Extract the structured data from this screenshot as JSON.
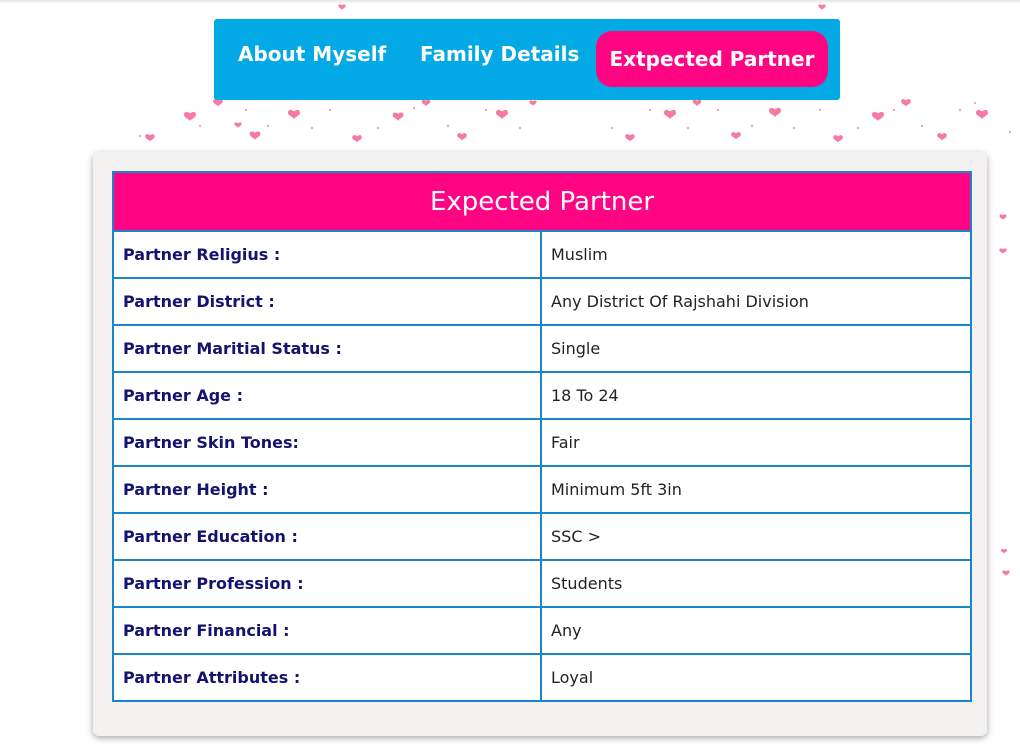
{
  "tabs": [
    {
      "label": "About Myself"
    },
    {
      "label": "Family Details"
    },
    {
      "label": "Extpected Partner"
    }
  ],
  "table": {
    "title": "Expected Partner",
    "rows": [
      {
        "label": "Partner Religius :",
        "value": "Muslim"
      },
      {
        "label": "Partner District :",
        "value": "Any District Of Rajshahi Division"
      },
      {
        "label": "Partner Maritial Status :",
        "value": "Single"
      },
      {
        "label": "Partner Age :",
        "value": "18 To 24"
      },
      {
        "label": "Partner Skin Tones:",
        "value": "Fair"
      },
      {
        "label": "Partner Height :",
        "value": "Minimum 5ft 3in"
      },
      {
        "label": "Partner Education :",
        "value": "SSC >"
      },
      {
        "label": "Partner Profession :",
        "value": "Students"
      },
      {
        "label": "Partner Financial :",
        "value": "Any"
      },
      {
        "label": "Partner Attributes :",
        "value": "Loyal"
      }
    ]
  },
  "colors": {
    "tab_bar": "#03a9e4",
    "active_tab": "#ff0583",
    "header": "#ff0583",
    "border": "#1a86c7",
    "label_text": "#14136e",
    "heart": "#f47ca3"
  },
  "icons": {
    "background_decoration": "heart-icon"
  }
}
